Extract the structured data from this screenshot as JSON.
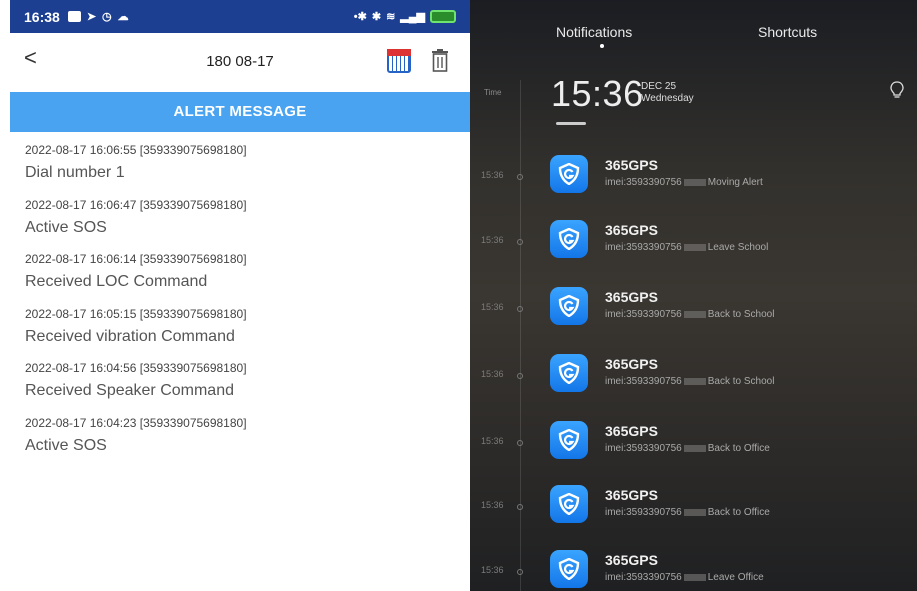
{
  "left_phone": {
    "status_bar": {
      "time": "16:38"
    },
    "nav": {
      "title": "180 08-17"
    },
    "alert_header": "ALERT MESSAGE",
    "messages": [
      {
        "meta": "2022-08-17 16:06:55  [359339075698180]",
        "text": "Dial number 1"
      },
      {
        "meta": "2022-08-17 16:06:47  [359339075698180]",
        "text": "Active SOS"
      },
      {
        "meta": "2022-08-17 16:06:14  [359339075698180]",
        "text": "Received LOC Command"
      },
      {
        "meta": "2022-08-17 16:05:15  [359339075698180]",
        "text": "Received vibration Command"
      },
      {
        "meta": "2022-08-17 16:04:56  [359339075698180]",
        "text": "Received Speaker Command"
      },
      {
        "meta": "2022-08-17 16:04:23  [359339075698180]",
        "text": "Active SOS"
      }
    ]
  },
  "right_phone": {
    "tabs": {
      "notifications": "Notifications",
      "shortcuts": "Shortcuts"
    },
    "time_tag": "Time",
    "clock": "15:36",
    "date_line1": "DEC 25",
    "date_line2": "Wednesday",
    "notifications": [
      {
        "time": "15:36",
        "app": "365GPS",
        "imei": "imei:3593390756",
        "event": "Moving Alert"
      },
      {
        "time": "15:36",
        "app": "365GPS",
        "imei": "imei:3593390756",
        "event": "Leave School"
      },
      {
        "time": "15:36",
        "app": "365GPS",
        "imei": "imei:3593390756",
        "event": "Back to School"
      },
      {
        "time": "15:36",
        "app": "365GPS",
        "imei": "imei:3593390756",
        "event": "Back to School"
      },
      {
        "time": "15:36",
        "app": "365GPS",
        "imei": "imei:3593390756",
        "event": "Back to Office"
      },
      {
        "time": "15:36",
        "app": "365GPS",
        "imei": "imei:3593390756",
        "event": "Back to Office"
      },
      {
        "time": "15:36",
        "app": "365GPS",
        "imei": "imei:3593390756",
        "event": "Leave Office"
      }
    ]
  }
}
